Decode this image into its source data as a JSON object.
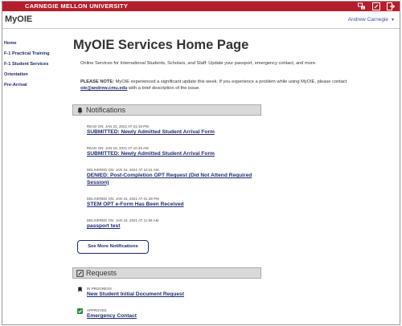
{
  "topbar": {
    "university": "CARNEGIE MELLON UNIVERSITY",
    "icons": [
      "language-icon",
      "edit-icon",
      "logout-icon"
    ]
  },
  "header": {
    "app_title": "MyOIE",
    "user_name": "Andrew Carnegie"
  },
  "sidebar": {
    "items": [
      {
        "label": "Home"
      },
      {
        "label": "F-1 Practical Training"
      },
      {
        "label": "F-1 Student Services"
      },
      {
        "label": "Orientation"
      },
      {
        "label": "Pre-Arrival"
      }
    ]
  },
  "main": {
    "title": "MyOIE Services Home Page",
    "intro": "Online Services for International Students, Scholars, and Staff: Update your passport, emergency contact, and more.",
    "notice_label": "PLEASE NOTE:",
    "notice_text": "MyOIE experienced a significant update this week. If you experience a problem while using MyOIE, please contact",
    "notice_email": "oie@andrew.cmu.edu",
    "notice_tail": "with a brief description of the issue."
  },
  "notifications": {
    "title": "Notifications",
    "items": [
      {
        "meta": "READ ON: JAN 22, 2021 AT 01:19 PM",
        "link": "SUBMITTED: Newly Admitted Student Arrival Form"
      },
      {
        "meta": "READ ON: JAN 18, 2021 AT 10:48 AM",
        "link": "SUBMITTED: Newly Admitted Student Arrival Form"
      },
      {
        "meta": "DELIVERED ON: JAN 16, 2021 AT 10:21 AM",
        "link": "DENIED: Post-Completion OPT Request (Did Not Attend Required Session)"
      },
      {
        "meta": "DELIVERED ON: JAN 15, 2021 AT 01:39 PM",
        "link": "STEM OPT e-Form Has Been Received"
      },
      {
        "meta": "DELIVERED ON: JAN 15, 2021 AT 11:56 AM",
        "link": "passport test"
      }
    ],
    "see_more": "See More Notifications"
  },
  "requests": {
    "title": "Requests",
    "items": [
      {
        "status": "IN PROGRESS",
        "link": "New Student Initial Document Request",
        "icon": "bookmark-icon",
        "color": "#222222"
      },
      {
        "status": "APPROVED",
        "link": "Emergency Contact",
        "icon": "check-icon",
        "color": "#2e8b3a"
      }
    ]
  },
  "colors": {
    "brand_red": "#b41f2b",
    "link_navy": "#1f2a6e",
    "section_gray": "#d9d9d9"
  }
}
